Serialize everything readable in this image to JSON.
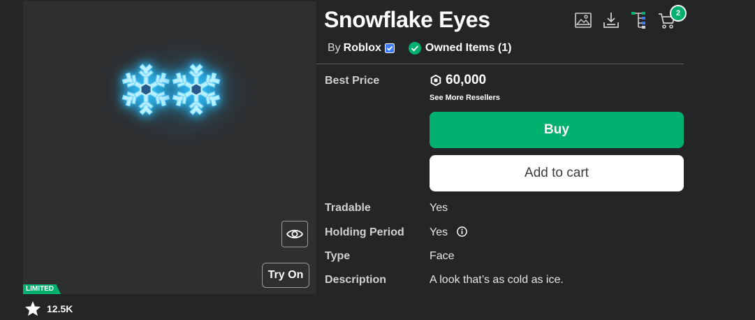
{
  "item": {
    "title": "Snowflake Eyes",
    "by_label": "By",
    "creator": "Roblox",
    "owned_label": "Owned Items (1)",
    "limited_badge": "LIMITED",
    "favorites": "12.5K"
  },
  "preview": {
    "try_on_label": "Try On",
    "icons": [
      "snowflake-icon",
      "eye-icon"
    ]
  },
  "toolbar": {
    "icons": [
      "image-icon",
      "download-icon",
      "hierarchy-icon",
      "cart-icon"
    ],
    "cart_count": "2"
  },
  "pricing": {
    "best_price_label": "Best Price",
    "price": "60,000",
    "see_more": "See More Resellers",
    "buy_label": "Buy",
    "add_to_cart_label": "Add to cart"
  },
  "details": [
    {
      "label": "Tradable",
      "value": "Yes"
    },
    {
      "label": "Holding Period",
      "value": "Yes"
    },
    {
      "label": "Type",
      "value": "Face"
    },
    {
      "label": "Description",
      "value": "A look that’s as cold as ice."
    }
  ],
  "colors": {
    "background": "#232527",
    "panel": "#2d2f31",
    "accent_green": "#00b06f",
    "verified_blue": "#3b7cff",
    "snowflake_glow": "#37c8ff"
  }
}
